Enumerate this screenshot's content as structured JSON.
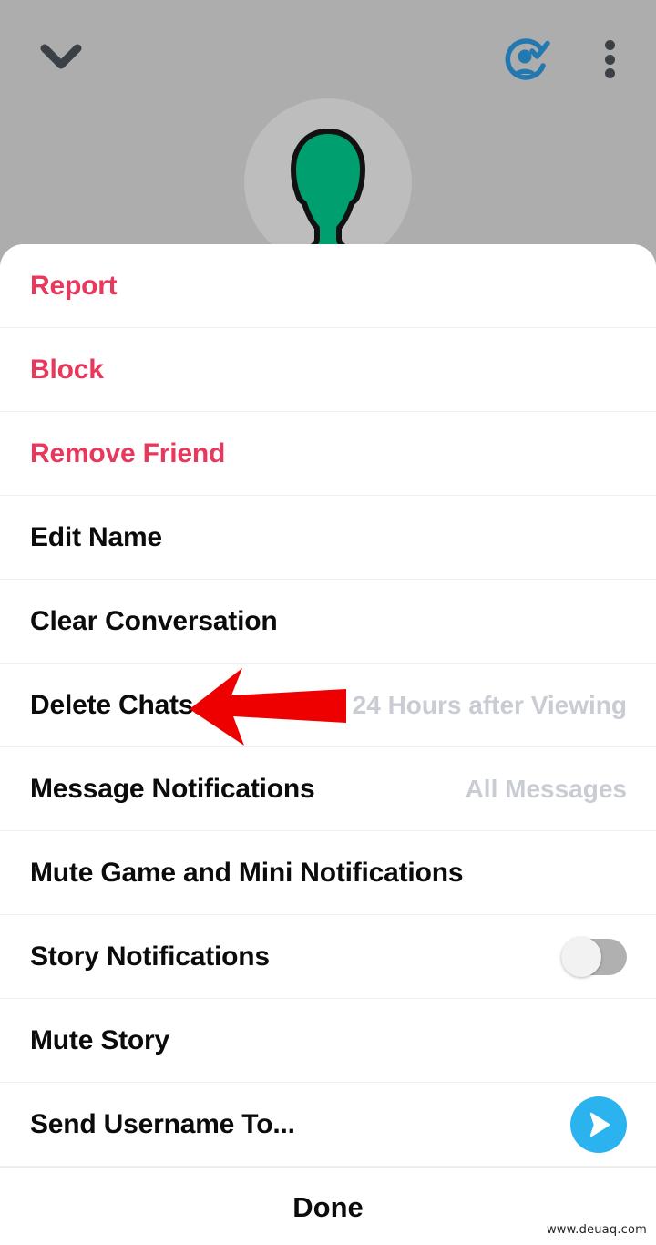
{
  "header": {
    "back_icon": "chevron-down-icon",
    "friend_added_icon": "person-check-icon",
    "more_icon": "kebab-menu-icon",
    "avatar_icon": "person-avatar-placeholder"
  },
  "colors": {
    "backdrop": "#adadad",
    "sheet": "#ffffff",
    "danger": "#e8385c",
    "primary_text": "#0b0b0b",
    "secondary_text": "#c9cdd3",
    "accent_blue": "#2bb3f0",
    "friend_icon_blue": "#2378b0",
    "avatar_green": "#009f6f",
    "annotation_arrow": "#ee0000"
  },
  "menu": {
    "items": [
      {
        "label": "Report",
        "style": "danger",
        "value": "",
        "control": "none"
      },
      {
        "label": "Block",
        "style": "danger",
        "value": "",
        "control": "none"
      },
      {
        "label": "Remove Friend",
        "style": "danger",
        "value": "",
        "control": "none"
      },
      {
        "label": "Edit Name",
        "style": "normal",
        "value": "",
        "control": "none"
      },
      {
        "label": "Clear Conversation",
        "style": "normal",
        "value": "",
        "control": "none"
      },
      {
        "label": "Delete Chats...",
        "style": "normal",
        "value": "24 Hours after Viewing",
        "control": "none"
      },
      {
        "label": "Message Notifications",
        "style": "normal",
        "value": "All Messages",
        "control": "none"
      },
      {
        "label": "Mute Game and Mini Notifications",
        "style": "normal",
        "value": "",
        "control": "none"
      },
      {
        "label": "Story Notifications",
        "style": "normal",
        "value": "",
        "control": "toggle"
      },
      {
        "label": "Mute Story",
        "style": "normal",
        "value": "",
        "control": "none"
      },
      {
        "label": "Send Username To...",
        "style": "normal",
        "value": "",
        "control": "send"
      }
    ],
    "done_label": "Done"
  },
  "controls": {
    "story_notifications_toggle": "off",
    "send_icon": "send-triangle-icon"
  },
  "annotation": {
    "arrow_icon": "left-pointing-arrow",
    "points_at": "Delete Chats..."
  },
  "watermark": {
    "text": "www.deuaq.com"
  }
}
